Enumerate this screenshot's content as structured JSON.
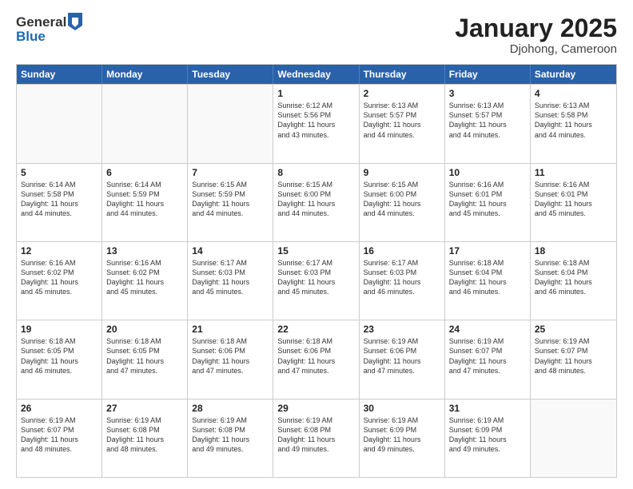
{
  "header": {
    "logo_line1": "General",
    "logo_line2": "Blue",
    "month_title": "January 2025",
    "location": "Djohong, Cameroon"
  },
  "weekdays": [
    "Sunday",
    "Monday",
    "Tuesday",
    "Wednesday",
    "Thursday",
    "Friday",
    "Saturday"
  ],
  "rows": [
    [
      {
        "day": "",
        "lines": [],
        "empty": true
      },
      {
        "day": "",
        "lines": [],
        "empty": true
      },
      {
        "day": "",
        "lines": [],
        "empty": true
      },
      {
        "day": "1",
        "lines": [
          "Sunrise: 6:12 AM",
          "Sunset: 5:56 PM",
          "Daylight: 11 hours",
          "and 43 minutes."
        ],
        "empty": false
      },
      {
        "day": "2",
        "lines": [
          "Sunrise: 6:13 AM",
          "Sunset: 5:57 PM",
          "Daylight: 11 hours",
          "and 44 minutes."
        ],
        "empty": false
      },
      {
        "day": "3",
        "lines": [
          "Sunrise: 6:13 AM",
          "Sunset: 5:57 PM",
          "Daylight: 11 hours",
          "and 44 minutes."
        ],
        "empty": false
      },
      {
        "day": "4",
        "lines": [
          "Sunrise: 6:13 AM",
          "Sunset: 5:58 PM",
          "Daylight: 11 hours",
          "and 44 minutes."
        ],
        "empty": false
      }
    ],
    [
      {
        "day": "5",
        "lines": [
          "Sunrise: 6:14 AM",
          "Sunset: 5:58 PM",
          "Daylight: 11 hours",
          "and 44 minutes."
        ],
        "empty": false
      },
      {
        "day": "6",
        "lines": [
          "Sunrise: 6:14 AM",
          "Sunset: 5:59 PM",
          "Daylight: 11 hours",
          "and 44 minutes."
        ],
        "empty": false
      },
      {
        "day": "7",
        "lines": [
          "Sunrise: 6:15 AM",
          "Sunset: 5:59 PM",
          "Daylight: 11 hours",
          "and 44 minutes."
        ],
        "empty": false
      },
      {
        "day": "8",
        "lines": [
          "Sunrise: 6:15 AM",
          "Sunset: 6:00 PM",
          "Daylight: 11 hours",
          "and 44 minutes."
        ],
        "empty": false
      },
      {
        "day": "9",
        "lines": [
          "Sunrise: 6:15 AM",
          "Sunset: 6:00 PM",
          "Daylight: 11 hours",
          "and 44 minutes."
        ],
        "empty": false
      },
      {
        "day": "10",
        "lines": [
          "Sunrise: 6:16 AM",
          "Sunset: 6:01 PM",
          "Daylight: 11 hours",
          "and 45 minutes."
        ],
        "empty": false
      },
      {
        "day": "11",
        "lines": [
          "Sunrise: 6:16 AM",
          "Sunset: 6:01 PM",
          "Daylight: 11 hours",
          "and 45 minutes."
        ],
        "empty": false
      }
    ],
    [
      {
        "day": "12",
        "lines": [
          "Sunrise: 6:16 AM",
          "Sunset: 6:02 PM",
          "Daylight: 11 hours",
          "and 45 minutes."
        ],
        "empty": false
      },
      {
        "day": "13",
        "lines": [
          "Sunrise: 6:16 AM",
          "Sunset: 6:02 PM",
          "Daylight: 11 hours",
          "and 45 minutes."
        ],
        "empty": false
      },
      {
        "day": "14",
        "lines": [
          "Sunrise: 6:17 AM",
          "Sunset: 6:03 PM",
          "Daylight: 11 hours",
          "and 45 minutes."
        ],
        "empty": false
      },
      {
        "day": "15",
        "lines": [
          "Sunrise: 6:17 AM",
          "Sunset: 6:03 PM",
          "Daylight: 11 hours",
          "and 45 minutes."
        ],
        "empty": false
      },
      {
        "day": "16",
        "lines": [
          "Sunrise: 6:17 AM",
          "Sunset: 6:03 PM",
          "Daylight: 11 hours",
          "and 46 minutes."
        ],
        "empty": false
      },
      {
        "day": "17",
        "lines": [
          "Sunrise: 6:18 AM",
          "Sunset: 6:04 PM",
          "Daylight: 11 hours",
          "and 46 minutes."
        ],
        "empty": false
      },
      {
        "day": "18",
        "lines": [
          "Sunrise: 6:18 AM",
          "Sunset: 6:04 PM",
          "Daylight: 11 hours",
          "and 46 minutes."
        ],
        "empty": false
      }
    ],
    [
      {
        "day": "19",
        "lines": [
          "Sunrise: 6:18 AM",
          "Sunset: 6:05 PM",
          "Daylight: 11 hours",
          "and 46 minutes."
        ],
        "empty": false
      },
      {
        "day": "20",
        "lines": [
          "Sunrise: 6:18 AM",
          "Sunset: 6:05 PM",
          "Daylight: 11 hours",
          "and 47 minutes."
        ],
        "empty": false
      },
      {
        "day": "21",
        "lines": [
          "Sunrise: 6:18 AM",
          "Sunset: 6:06 PM",
          "Daylight: 11 hours",
          "and 47 minutes."
        ],
        "empty": false
      },
      {
        "day": "22",
        "lines": [
          "Sunrise: 6:18 AM",
          "Sunset: 6:06 PM",
          "Daylight: 11 hours",
          "and 47 minutes."
        ],
        "empty": false
      },
      {
        "day": "23",
        "lines": [
          "Sunrise: 6:19 AM",
          "Sunset: 6:06 PM",
          "Daylight: 11 hours",
          "and 47 minutes."
        ],
        "empty": false
      },
      {
        "day": "24",
        "lines": [
          "Sunrise: 6:19 AM",
          "Sunset: 6:07 PM",
          "Daylight: 11 hours",
          "and 47 minutes."
        ],
        "empty": false
      },
      {
        "day": "25",
        "lines": [
          "Sunrise: 6:19 AM",
          "Sunset: 6:07 PM",
          "Daylight: 11 hours",
          "and 48 minutes."
        ],
        "empty": false
      }
    ],
    [
      {
        "day": "26",
        "lines": [
          "Sunrise: 6:19 AM",
          "Sunset: 6:07 PM",
          "Daylight: 11 hours",
          "and 48 minutes."
        ],
        "empty": false
      },
      {
        "day": "27",
        "lines": [
          "Sunrise: 6:19 AM",
          "Sunset: 6:08 PM",
          "Daylight: 11 hours",
          "and 48 minutes."
        ],
        "empty": false
      },
      {
        "day": "28",
        "lines": [
          "Sunrise: 6:19 AM",
          "Sunset: 6:08 PM",
          "Daylight: 11 hours",
          "and 49 minutes."
        ],
        "empty": false
      },
      {
        "day": "29",
        "lines": [
          "Sunrise: 6:19 AM",
          "Sunset: 6:08 PM",
          "Daylight: 11 hours",
          "and 49 minutes."
        ],
        "empty": false
      },
      {
        "day": "30",
        "lines": [
          "Sunrise: 6:19 AM",
          "Sunset: 6:09 PM",
          "Daylight: 11 hours",
          "and 49 minutes."
        ],
        "empty": false
      },
      {
        "day": "31",
        "lines": [
          "Sunrise: 6:19 AM",
          "Sunset: 6:09 PM",
          "Daylight: 11 hours",
          "and 49 minutes."
        ],
        "empty": false
      },
      {
        "day": "",
        "lines": [],
        "empty": true
      }
    ]
  ]
}
